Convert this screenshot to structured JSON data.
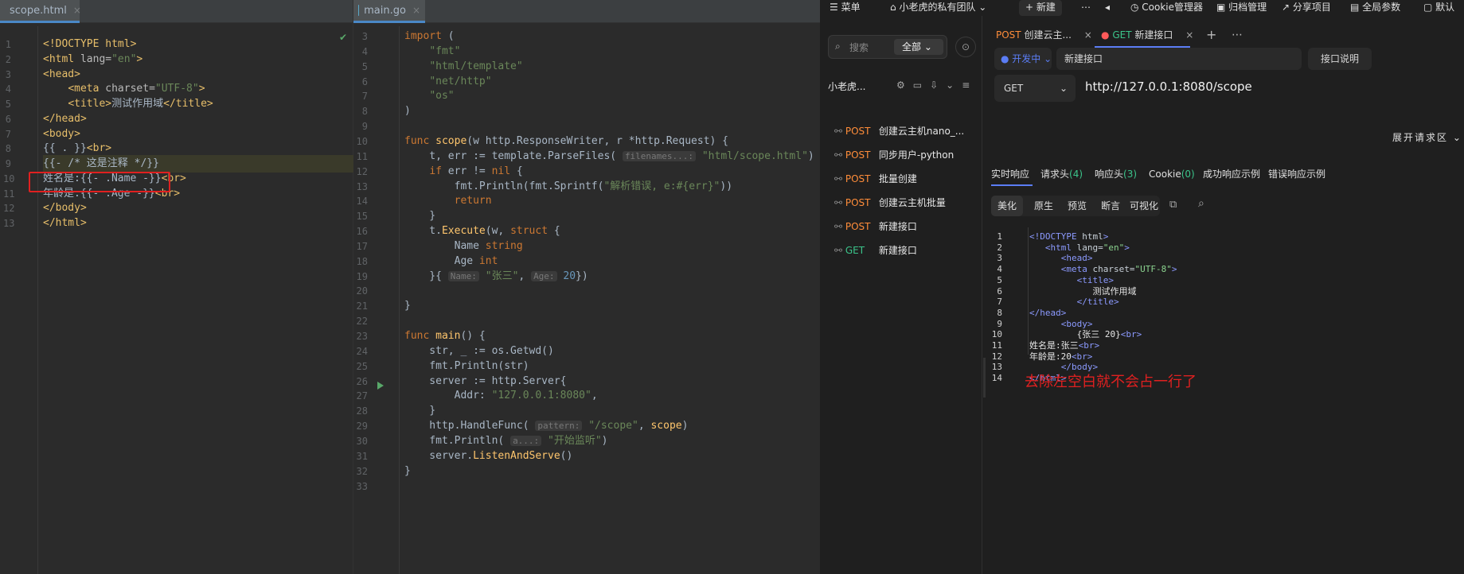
{
  "left_editor": {
    "tab": {
      "label": "scope.html",
      "close": "×"
    },
    "lines": [
      {
        "n": "1",
        "html": "<span class='t-tag'>&lt;!DOCTYPE html&gt;</span>"
      },
      {
        "n": "2",
        "html": "<span class='t-tag'>&lt;html </span><span class='t-attr'>lang=</span><span class='t-val'>\"en\"</span><span class='t-tag'>&gt;</span>"
      },
      {
        "n": "3",
        "html": "<span class='t-tag'>&lt;head&gt;</span>"
      },
      {
        "n": "4",
        "html": "    <span class='t-tag'>&lt;meta </span><span class='t-attr'>charset=</span><span class='t-val'>\"UTF-8\"</span><span class='t-tag'>&gt;</span>"
      },
      {
        "n": "5",
        "html": "    <span class='t-tag'>&lt;title&gt;</span><span class='t-txt'>测试作用域</span><span class='t-tag'>&lt;/title&gt;</span>"
      },
      {
        "n": "6",
        "html": "<span class='t-tag'>&lt;/head&gt;</span>"
      },
      {
        "n": "7",
        "html": "<span class='t-tag'>&lt;body&gt;</span>"
      },
      {
        "n": "8",
        "html": "<span class='t-txt'>{{ . }}</span><span class='t-tag'>&lt;br&gt;</span>"
      },
      {
        "n": "9",
        "html": "<span class='t-txt'>{{- /* 这是注释 */}}</span>"
      },
      {
        "n": "10",
        "html": "<span class='t-txt'>姓名是:{{- .Name -}}</span><span class='t-tag'>&lt;br&gt;</span>"
      },
      {
        "n": "11",
        "html": "<span class='t-txt'>年龄是:{{- .Age -}}</span><span class='t-tag'>&lt;br&gt;</span>"
      },
      {
        "n": "12",
        "html": "<span class='t-tag'>&lt;/body&gt;</span>"
      },
      {
        "n": "13",
        "html": "<span class='t-tag'>&lt;/html&gt;</span>"
      }
    ]
  },
  "mid_editor": {
    "tab": {
      "label": "main.go",
      "close": "×"
    },
    "lines": [
      {
        "n": "3",
        "html": "<span class='t-kw'>import</span> ("
      },
      {
        "n": "4",
        "html": "    <span class='t-str'>\"fmt\"</span>"
      },
      {
        "n": "5",
        "html": "    <span class='t-str'>\"html/template\"</span>"
      },
      {
        "n": "6",
        "html": "    <span class='t-str'>\"net/http\"</span>"
      },
      {
        "n": "7",
        "html": "    <span class='t-str'>\"os\"</span>"
      },
      {
        "n": "8",
        "html": ")"
      },
      {
        "n": "9",
        "html": ""
      },
      {
        "n": "10",
        "html": "<span class='t-kw'>func</span> <span class='t-fn'>scope</span>(w http.ResponseWriter, r *http.Request) {"
      },
      {
        "n": "11",
        "html": "    t, err := template.ParseFiles( <span class='t-hint'>filenames...:</span> <span class='t-str'>\"html/scope.html\"</span>)"
      },
      {
        "n": "12",
        "html": "    <span class='t-kw'>if</span> err != <span class='t-kw'>nil</span> {"
      },
      {
        "n": "13",
        "html": "        fmt.Println(fmt.Sprintf(<span class='t-str'>\"解析错误, e:#{err}\"</span>))"
      },
      {
        "n": "14",
        "html": "        <span class='t-kw'>return</span>"
      },
      {
        "n": "15",
        "html": "    }"
      },
      {
        "n": "16",
        "html": "    t.<span class='t-fn'>Execute</span>(w, <span class='t-kw'>struct</span> {"
      },
      {
        "n": "17",
        "html": "        Name <span class='t-kw'>string</span>"
      },
      {
        "n": "18",
        "html": "        Age <span class='t-kw'>int</span>"
      },
      {
        "n": "19",
        "html": "    }{ <span class='t-hint'>Name:</span> <span class='t-str'>\"张三\"</span>, <span class='t-hint'>Age:</span> <span class='t-num'>20</span>})"
      },
      {
        "n": "20",
        "html": ""
      },
      {
        "n": "21",
        "html": "}"
      },
      {
        "n": "22",
        "html": ""
      },
      {
        "n": "23",
        "html": "<span class='t-kw'>func</span> <span class='t-fn'>main</span>() {"
      },
      {
        "n": "24",
        "html": "    str, _ := os.Getwd()"
      },
      {
        "n": "25",
        "html": "    fmt.Println(str)"
      },
      {
        "n": "26",
        "html": "    server := http.Server{"
      },
      {
        "n": "27",
        "html": "        Addr: <span class='t-str'>\"127.0.0.1:8080\"</span>,"
      },
      {
        "n": "28",
        "html": "    }"
      },
      {
        "n": "29",
        "html": "    http.HandleFunc( <span class='t-hint'>pattern:</span> <span class='t-str'>\"/scope\"</span>, <span class='t-fn'>scope</span>)"
      },
      {
        "n": "30",
        "html": "    fmt.Println( <span class='t-hint'>a...:</span> <span class='t-str'>\"开始监听\"</span>)"
      },
      {
        "n": "31",
        "html": "    server.<span class='t-fn'>ListenAndServe</span>()"
      },
      {
        "n": "32",
        "html": "}"
      },
      {
        "n": "33",
        "html": ""
      }
    ]
  },
  "topbar": {
    "menu": "菜单",
    "team": "小老虎的私有团队",
    "new": "新建",
    "cookie": "Cookie管理器",
    "archive": "归档管理",
    "share": "分享项目",
    "global_params": "全局参数",
    "default": "默认"
  },
  "sidebar": {
    "search_placeholder": "搜索",
    "scope_filter": "全部",
    "project_name": "小老虎...",
    "items": [
      {
        "method": "POST",
        "name": "创建云主机nano_..."
      },
      {
        "method": "POST",
        "name": "同步用户-python"
      },
      {
        "method": "POST",
        "name": "批量创建"
      },
      {
        "method": "POST",
        "name": "创建云主机批量"
      },
      {
        "method": "POST",
        "name": "新建接口"
      },
      {
        "method": "GET",
        "name": "新建接口"
      }
    ]
  },
  "main": {
    "tabs": [
      {
        "method": "POST",
        "label": "创建云主..."
      },
      {
        "method": "GET",
        "label": "新建接口"
      }
    ],
    "env": "开发中",
    "request_name": "新建接口",
    "doc_button": "接口说明",
    "http_method": "GET",
    "url": "http://127.0.0.1:8080/scope",
    "expand": "展开请求区",
    "resp_tabs": [
      {
        "label": "实时响应",
        "count": ""
      },
      {
        "label": "请求头",
        "count": "4"
      },
      {
        "label": "响应头",
        "count": "3"
      },
      {
        "label": "Cookie",
        "count": "0"
      },
      {
        "label": "成功响应示例",
        "count": ""
      },
      {
        "label": "错误响应示例",
        "count": ""
      }
    ],
    "format_buttons": [
      "美化",
      "原生",
      "预览",
      "断言",
      "可视化"
    ],
    "response_lines": [
      {
        "n": "1",
        "html": "<span class='r-tag'>&lt;!DOCTYPE </span><span class='r-attr'>html</span><span class='r-tag'>&gt;</span>"
      },
      {
        "n": "2",
        "html": "   <span class='r-tag'>&lt;html </span><span class='r-attr'>lang=</span><span class='r-val'>\"en\"</span><span class='r-tag'>&gt;</span>"
      },
      {
        "n": "3",
        "html": "      <span class='r-tag'>&lt;head&gt;</span>"
      },
      {
        "n": "4",
        "html": "      <span class='r-tag'>&lt;meta </span><span class='r-attr'>charset=</span><span class='r-val'>\"UTF-8\"</span><span class='r-tag'>&gt;</span>"
      },
      {
        "n": "5",
        "html": "         <span class='r-tag'>&lt;title&gt;</span>"
      },
      {
        "n": "6",
        "html": "            <span class='r-txt'>测试作用域</span>"
      },
      {
        "n": "7",
        "html": "         <span class='r-tag'>&lt;/title&gt;</span>"
      },
      {
        "n": "8",
        "html": "<span class='r-tag'>&lt;/head&gt;</span>"
      },
      {
        "n": "9",
        "html": "      <span class='r-tag'>&lt;body&gt;</span>"
      },
      {
        "n": "10",
        "html": "         <span class='r-txt'>{张三 20}</span><span class='r-tag'>&lt;br&gt;</span>"
      },
      {
        "n": "11",
        "html": "<span class='r-txt'>姓名是:张三</span><span class='r-tag'>&lt;br&gt;</span>"
      },
      {
        "n": "12",
        "html": "<span class='r-txt'>年龄是:20</span><span class='r-tag'>&lt;br&gt;</span>"
      },
      {
        "n": "13",
        "html": "      <span class='r-tag'>&lt;/body&gt;</span>"
      },
      {
        "n": "14",
        "html": "<span class='r-tag'>&lt;/html&gt;</span>"
      }
    ],
    "annotation": "去除左空白就不会占一行了"
  },
  "colors": {
    "annotation_red": "#e02020",
    "post": "#ff8d3a",
    "get": "#3bc48a",
    "accent": "#5b7df5"
  }
}
